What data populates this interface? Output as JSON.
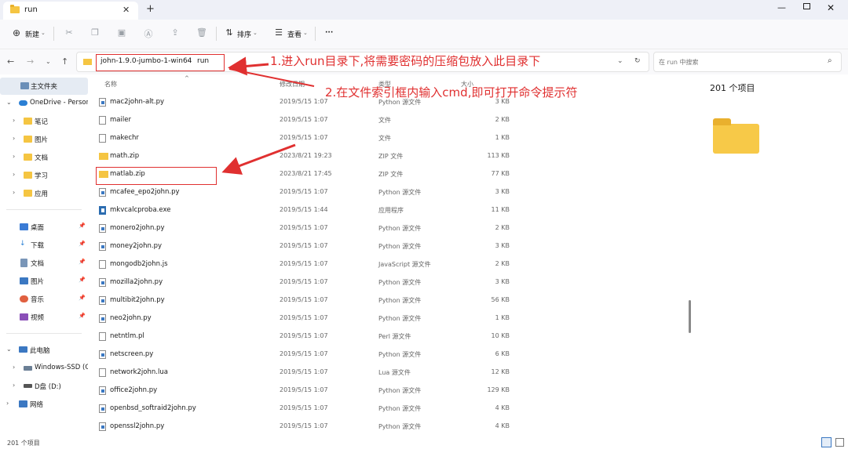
{
  "window": {
    "tab_title": "run",
    "close_glyph": "✕",
    "add_glyph": "+",
    "min_glyph": "—",
    "winclose_glyph": "✕"
  },
  "commandbar": {
    "new_label": "新建",
    "sort_label": "排序",
    "view_label": "查看",
    "more_glyph": "···",
    "icons": [
      "plus-circle-icon",
      "cut-icon",
      "copy-icon",
      "paste-icon",
      "rename-icon",
      "share-icon",
      "delete-icon",
      "sort-icon",
      "view-icon"
    ]
  },
  "address": {
    "crumbs": [
      "john-1.9.0-jumbo-1-win64",
      "run"
    ],
    "separator": "›",
    "search_placeholder": "在 run 中搜索"
  },
  "sidebar": {
    "home": "主文件夹",
    "onedrive": "OneDrive - Persor",
    "onedrive_folders": [
      "笔记",
      "图片",
      "文档",
      "学习",
      "应用"
    ],
    "quick_access": [
      "桌面",
      "下载",
      "文档",
      "图片",
      "音乐",
      "视频"
    ],
    "this_pc": "此电脑",
    "drives": [
      "Windows-SSD (C",
      "D盘 (D:)"
    ],
    "network": "网络"
  },
  "columns": {
    "name": "名称",
    "modified": "修改日期",
    "type": "类型",
    "size": "大小"
  },
  "files": [
    {
      "name": "mac2john-alt.py",
      "date": "2019/5/15 1:07",
      "type": "Python 源文件",
      "size": "3 KB",
      "kind": "py"
    },
    {
      "name": "mailer",
      "date": "2019/5/15 1:07",
      "type": "文件",
      "size": "2 KB",
      "kind": "file"
    },
    {
      "name": "makechr",
      "date": "2019/5/15 1:07",
      "type": "文件",
      "size": "1 KB",
      "kind": "file"
    },
    {
      "name": "math.zip",
      "date": "2023/8/21 19:23",
      "type": "ZIP 文件",
      "size": "113 KB",
      "kind": "zip"
    },
    {
      "name": "matlab.zip",
      "date": "2023/8/21 17:45",
      "type": "ZIP 文件",
      "size": "77 KB",
      "kind": "zip"
    },
    {
      "name": "mcafee_epo2john.py",
      "date": "2019/5/15 1:07",
      "type": "Python 源文件",
      "size": "3 KB",
      "kind": "py"
    },
    {
      "name": "mkvcalcproba.exe",
      "date": "2019/5/15 1:44",
      "type": "应用程序",
      "size": "11 KB",
      "kind": "exe"
    },
    {
      "name": "monero2john.py",
      "date": "2019/5/15 1:07",
      "type": "Python 源文件",
      "size": "2 KB",
      "kind": "py"
    },
    {
      "name": "money2john.py",
      "date": "2019/5/15 1:07",
      "type": "Python 源文件",
      "size": "3 KB",
      "kind": "py"
    },
    {
      "name": "mongodb2john.js",
      "date": "2019/5/15 1:07",
      "type": "JavaScript 源文件",
      "size": "2 KB",
      "kind": "file"
    },
    {
      "name": "mozilla2john.py",
      "date": "2019/5/15 1:07",
      "type": "Python 源文件",
      "size": "3 KB",
      "kind": "py"
    },
    {
      "name": "multibit2john.py",
      "date": "2019/5/15 1:07",
      "type": "Python 源文件",
      "size": "56 KB",
      "kind": "py"
    },
    {
      "name": "neo2john.py",
      "date": "2019/5/15 1:07",
      "type": "Python 源文件",
      "size": "1 KB",
      "kind": "py"
    },
    {
      "name": "netntlm.pl",
      "date": "2019/5/15 1:07",
      "type": "Perl 源文件",
      "size": "10 KB",
      "kind": "file"
    },
    {
      "name": "netscreen.py",
      "date": "2019/5/15 1:07",
      "type": "Python 源文件",
      "size": "6 KB",
      "kind": "py"
    },
    {
      "name": "network2john.lua",
      "date": "2019/5/15 1:07",
      "type": "Lua 源文件",
      "size": "12 KB",
      "kind": "file"
    },
    {
      "name": "office2john.py",
      "date": "2019/5/15 1:07",
      "type": "Python 源文件",
      "size": "129 KB",
      "kind": "py"
    },
    {
      "name": "openbsd_softraid2john.py",
      "date": "2019/5/15 1:07",
      "type": "Python 源文件",
      "size": "4 KB",
      "kind": "py"
    },
    {
      "name": "openssl2john.py",
      "date": "2019/5/15 1:07",
      "type": "Python 源文件",
      "size": "4 KB",
      "kind": "py"
    }
  ],
  "details": {
    "count": "201 个项目"
  },
  "status": {
    "text": "201 个项目"
  },
  "annotations": {
    "step1": "1.进入run目录下,将需要密码的压缩包放入此目录下",
    "step2": "2.在文件索引框内输入cmd,即可打开命令提示符",
    "color": "#e03030"
  },
  "colors": {
    "folder": "#f5c542",
    "accent": "#3b78c2",
    "selected": "#e5ebf3"
  }
}
